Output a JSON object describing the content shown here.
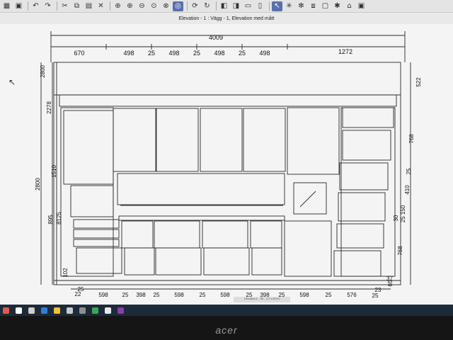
{
  "window": {
    "title": "Elevation - 1 : Vägg - 1, Elevation med mått",
    "status": "Elevation1  - 3D  - 2.0 1/2024"
  },
  "toolbar": {
    "icons": [
      "grid-icon",
      "image-icon",
      "undo-icon",
      "redo-icon",
      "cut-icon",
      "copy-icon",
      "paste-icon",
      "delete-icon",
      "zoom-icon",
      "zoom-in-icon",
      "zoom-out-icon",
      "zoom-fit-icon",
      "pan-icon",
      "orbit-icon",
      "refresh-icon",
      "rotate-icon",
      "shape-icon",
      "layer-icon",
      "plan-icon",
      "elevation-icon",
      "pointer-icon",
      "measure-icon",
      "settings-icon",
      "window-icon"
    ]
  },
  "dimensions": {
    "top_total": "4009",
    "top_segments": [
      "670",
      "498",
      "25",
      "498",
      "25",
      "498",
      "25",
      "498",
      "1272"
    ],
    "left_outer": [
      "2800",
      "2278",
      "2800",
      "1510",
      "895",
      "8125",
      "102"
    ],
    "right_outer": [
      "522",
      "768",
      "25",
      "410",
      "30",
      "25 150",
      "768",
      "37",
      "65"
    ],
    "bottom": [
      "25",
      "22",
      "598",
      "25",
      "398",
      "25",
      "598",
      "25",
      "598",
      "25",
      "398",
      "25",
      "598",
      "25",
      "576",
      "25",
      "23"
    ]
  },
  "taskbar": {
    "icons": [
      "windows-start-icon",
      "search-icon",
      "task-view-icon",
      "edge-icon",
      "file-explorer-icon",
      "mail-icon",
      "settings-icon",
      "chrome-icon",
      "app-icon",
      "active-app-icon"
    ]
  },
  "monitor": {
    "brand": "acer"
  },
  "colors": {
    "accent": "#5a6fae",
    "line": "#2a2a2a",
    "taskbar": "#1d2a3a"
  }
}
